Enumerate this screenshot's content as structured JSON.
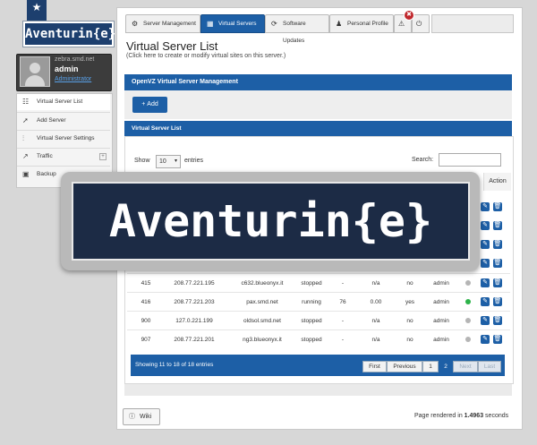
{
  "brand": {
    "name": "Aventurin{e}",
    "ribbon_icon": "star-icon"
  },
  "user": {
    "host": "zebra.smd.net",
    "name": "admin",
    "role": "Administrator"
  },
  "sidebar": {
    "items": [
      {
        "label": "Virtual Server List",
        "icon": "list-icon"
      },
      {
        "label": "Add Server",
        "icon": "arrow-icon"
      },
      {
        "label": "Virtual Server Settings",
        "icon": "sliders-icon"
      },
      {
        "label": "Traffic",
        "icon": "chart-icon"
      },
      {
        "label": "Backup",
        "icon": "disk-icon"
      }
    ]
  },
  "tabs": [
    {
      "label": "Server Management",
      "icon": "gear-icon"
    },
    {
      "label": "Virtual Servers",
      "icon": "grid-icon",
      "active": true
    },
    {
      "label": "Software Updates",
      "icon": "refresh-icon"
    },
    {
      "label": "Personal Profile",
      "icon": "person-icon"
    }
  ],
  "alert_badge": "✖",
  "page": {
    "title": "Virtual Server List",
    "subtitle": "(Click here to create or modify virtual sites on this server.)"
  },
  "openvz": {
    "title": "OpenVZ Virtual Server Management",
    "add_label": "Add"
  },
  "list": {
    "title": "Virtual Server List",
    "show_label": "Show",
    "page_size": "10",
    "entries_label": "entries",
    "search_label": "Search:",
    "action_header": "Action",
    "rows": [
      {
        "id": "415",
        "ip": "208.77.221.195",
        "host": "c632.blueonyx.it",
        "state": "stopped",
        "col5": "-",
        "col6": "n/a",
        "col7": "no",
        "owner": "admin",
        "status_color": "#b5b5b5"
      },
      {
        "id": "416",
        "ip": "208.77.221.203",
        "host": "pax.smd.net",
        "state": "running",
        "col5": "76",
        "col6": "0.00",
        "col7": "yes",
        "owner": "admin",
        "status_color": "#2db34a"
      },
      {
        "id": "900",
        "ip": "127.0.221.199",
        "host": "oldsol.smd.net",
        "state": "stopped",
        "col5": "-",
        "col6": "n/a",
        "col7": "no",
        "owner": "admin",
        "status_color": "#b5b5b5"
      },
      {
        "id": "907",
        "ip": "208.77.221.201",
        "host": "ng3.blueonyx.it",
        "state": "stopped",
        "col5": "-",
        "col6": "n/a",
        "col7": "no",
        "owner": "admin",
        "status_color": "#b5b5b5"
      }
    ],
    "showing": "Showing 11 to 18 of 18 entries",
    "pager": {
      "first": "First",
      "previous": "Previous",
      "p1": "1",
      "p2": "2",
      "next": "Next",
      "last": "Last"
    }
  },
  "footer": {
    "wiki_label": "Wiki",
    "rendered_prefix": "Page rendered in",
    "rendered_value": "1.4963",
    "rendered_suffix": "seconds"
  },
  "colors": {
    "accent": "#1d5fa6",
    "brand_dark": "#1c2b45"
  }
}
